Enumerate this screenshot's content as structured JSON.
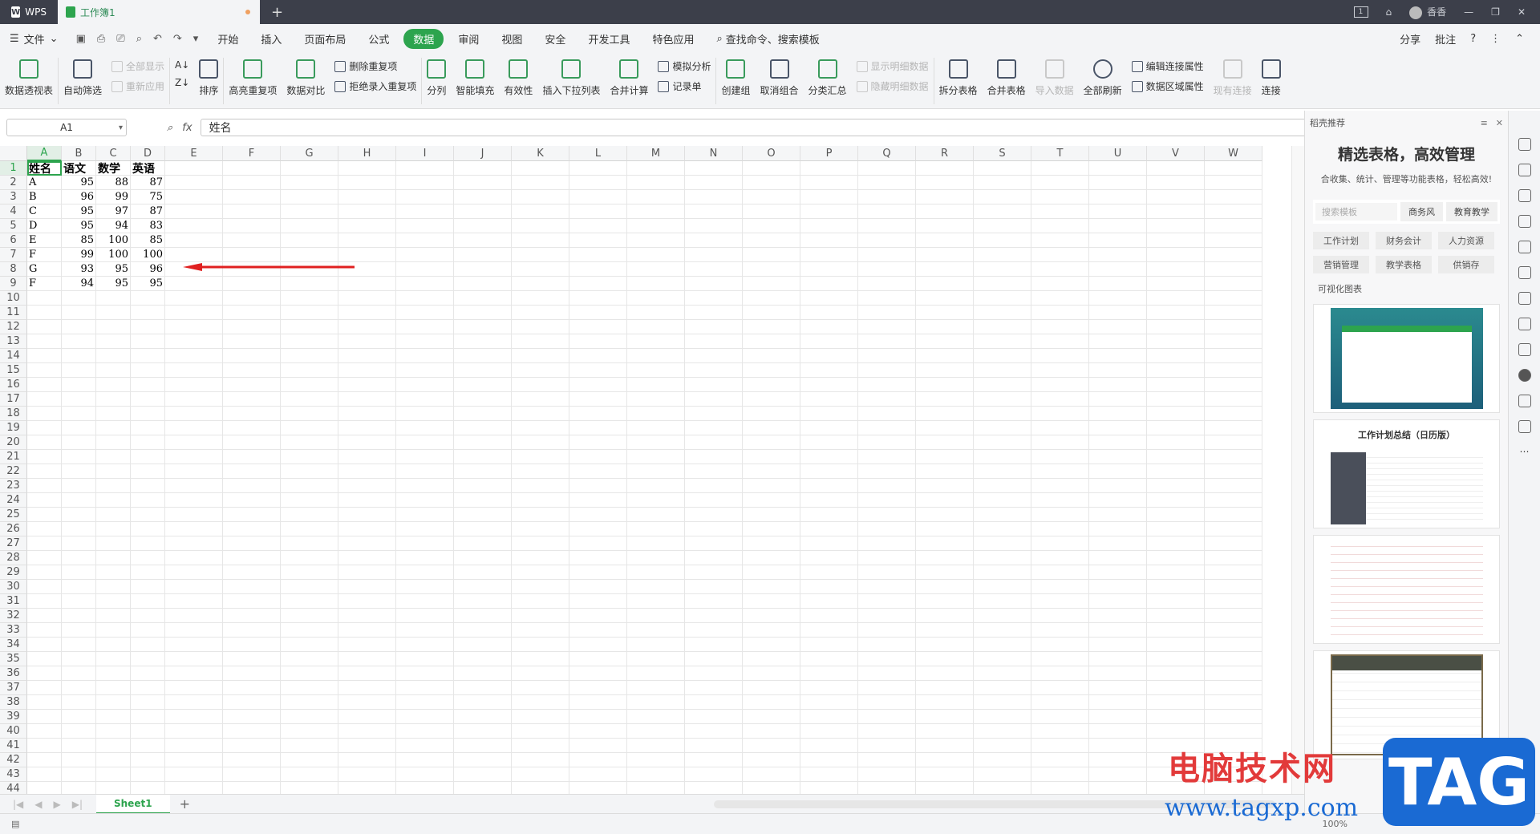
{
  "app": {
    "brand": "WPS",
    "doc_tab": "工作簿1",
    "new_tab": "+",
    "page_indicator": "1",
    "user": "香香"
  },
  "menu": {
    "file": "文件",
    "items": [
      "开始",
      "插入",
      "页面布局",
      "公式",
      "数据",
      "审阅",
      "视图",
      "安全",
      "开发工具",
      "特色应用"
    ],
    "active": "数据",
    "search": "查找命令、搜索模板",
    "share": "分享",
    "comment": "批注",
    "help": "?"
  },
  "ribbon": {
    "pivot": "数据透视表",
    "autofilter": "自动筛选",
    "show_all": "全部显示",
    "reapply": "重新应用",
    "sort": "排序",
    "highlight_dup": "高亮重复项",
    "compare": "数据对比",
    "remove_dup": "删除重复项",
    "reject_dup": "拒绝录入重复项",
    "split": "分列",
    "smart_fill": "智能填充",
    "validity": "有效性",
    "dropdown": "插入下拉列表",
    "consolidate": "合并计算",
    "whatif": "模拟分析",
    "record": "记录单",
    "group": "创建组",
    "ungroup": "取消组合",
    "subtotal": "分类汇总",
    "show_detail": "显示明细数据",
    "hide_detail": "隐藏明细数据",
    "split_table": "拆分表格",
    "merge_table": "合并表格",
    "import": "导入数据",
    "refresh_all": "全部刷新",
    "edit_conn": "编辑连接属性",
    "range_prop": "数据区域属性",
    "existing_conn": "现有连接",
    "connect": "连接"
  },
  "formula_bar": {
    "cell_ref": "A1",
    "fx": "fx",
    "value": "姓名"
  },
  "columns": [
    "A",
    "B",
    "C",
    "D",
    "E",
    "F",
    "G",
    "H",
    "I",
    "J",
    "K",
    "L",
    "M",
    "N",
    "O",
    "P",
    "Q",
    "R",
    "S",
    "T",
    "U",
    "V",
    "W"
  ],
  "table": {
    "header": [
      "姓名",
      "语文",
      "数学",
      "英语"
    ],
    "rows": [
      [
        "A",
        "95",
        "88",
        "87"
      ],
      [
        "B",
        "96",
        "99",
        "75"
      ],
      [
        "C",
        "95",
        "97",
        "87"
      ],
      [
        "D",
        "95",
        "94",
        "83"
      ],
      [
        "E",
        "85",
        "100",
        "85"
      ],
      [
        "F",
        "99",
        "100",
        "100"
      ],
      [
        "G",
        "93",
        "95",
        "96"
      ],
      [
        "F",
        "94",
        "95",
        "95"
      ]
    ]
  },
  "row_count": 44,
  "sheets": {
    "active": "Sheet1",
    "add": "+"
  },
  "panel": {
    "header": "稻壳推荐",
    "title": "精选表格，高效管理",
    "subtitle": "合收集、统计、管理等功能表格，轻松高效!",
    "search_placeholder": "搜索模板",
    "tags": [
      "商务风",
      "教育教学"
    ],
    "categories": [
      "工作计划",
      "财务会计",
      "人力资源",
      "营销管理",
      "教学表格",
      "供销存"
    ],
    "extra_category": "可视化图表",
    "thumb2_title": "工作计划总结（日历版）"
  },
  "status": {
    "zoom": "100%"
  },
  "watermark": {
    "cn": "电脑技术网",
    "url": "www.tagxp.com",
    "tag": "TAG"
  },
  "colors": {
    "accent": "#2da44e",
    "arrow": "#e02020"
  }
}
